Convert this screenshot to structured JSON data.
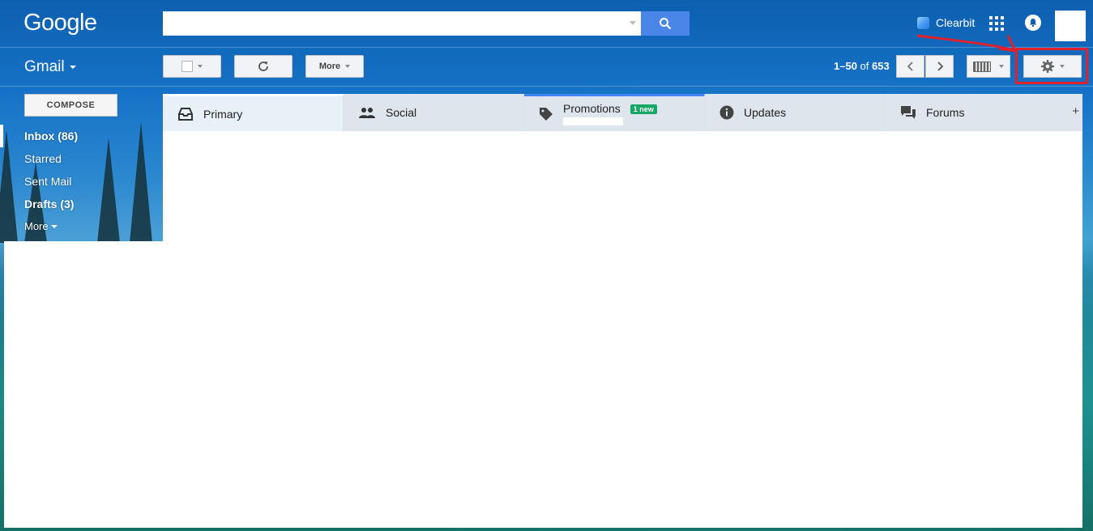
{
  "header": {
    "logo_text": "Google",
    "search": {
      "value": "",
      "placeholder": ""
    },
    "clearbit_label": "Clearbit",
    "icons": [
      "search-icon",
      "apps-grid-icon",
      "notifications-bell-icon",
      "account-avatar"
    ]
  },
  "toolbar": {
    "app_label": "Gmail",
    "more_label": "More",
    "page_range": "1–50",
    "page_of": "of",
    "page_total": "653"
  },
  "sidebar": {
    "compose_label": "COMPOSE",
    "items": [
      {
        "label": "Inbox (86)"
      },
      {
        "label": "Starred"
      },
      {
        "label": "Sent Mail"
      },
      {
        "label": "Drafts (3)"
      },
      {
        "label": "More"
      }
    ]
  },
  "tabs": [
    {
      "label": "Primary",
      "icon": "inbox-icon"
    },
    {
      "label": "Social",
      "icon": "people-icon"
    },
    {
      "label": "Promotions",
      "icon": "tag-icon",
      "badge": "1 new"
    },
    {
      "label": "Updates",
      "icon": "info-icon"
    },
    {
      "label": "Forums",
      "icon": "chat-bubbles-icon"
    }
  ],
  "tab_add_label": "+",
  "colors": {
    "search_button": "#4a86e8",
    "promotions_badge": "#16a765",
    "highlight_annotation": "#e0202a"
  }
}
